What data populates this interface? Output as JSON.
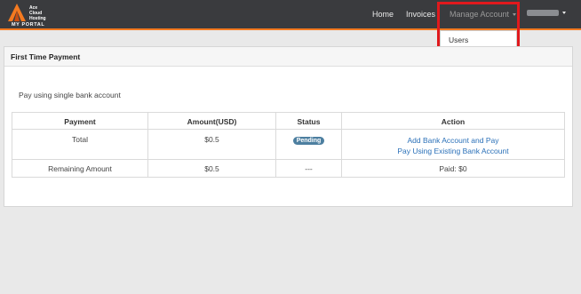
{
  "brand": {
    "logo_lines": [
      "Ace",
      "Cloud",
      "Hosting"
    ],
    "portal_label": "MY PORTAL",
    "icon": "ace-logo-icon",
    "accent_color": "#f47a20"
  },
  "nav": {
    "home": "Home",
    "invoices": "Invoices",
    "manage_account": "Manage Account",
    "manage_dropdown_items": [
      "Users"
    ],
    "user_name_redacted": true
  },
  "panel": {
    "title": "First Time Payment",
    "subtitle": "Pay using single bank account"
  },
  "table": {
    "headers": [
      "Payment",
      "Amount(USD)",
      "Status",
      "Action"
    ],
    "rows": [
      {
        "payment": "Total",
        "amount": "$0.5",
        "status": "Pending",
        "actions": [
          "Add Bank Account and Pay",
          "Pay Using Existing Bank Account"
        ]
      },
      {
        "payment": "Remaining Amount",
        "amount": "$0.5",
        "status": "---",
        "action_text": "Paid: $0"
      }
    ]
  },
  "colors": {
    "navbar_bg": "#3a3b3e",
    "highlight": "#e0191d",
    "link": "#2a70b8",
    "badge": "#4d7fa0"
  }
}
